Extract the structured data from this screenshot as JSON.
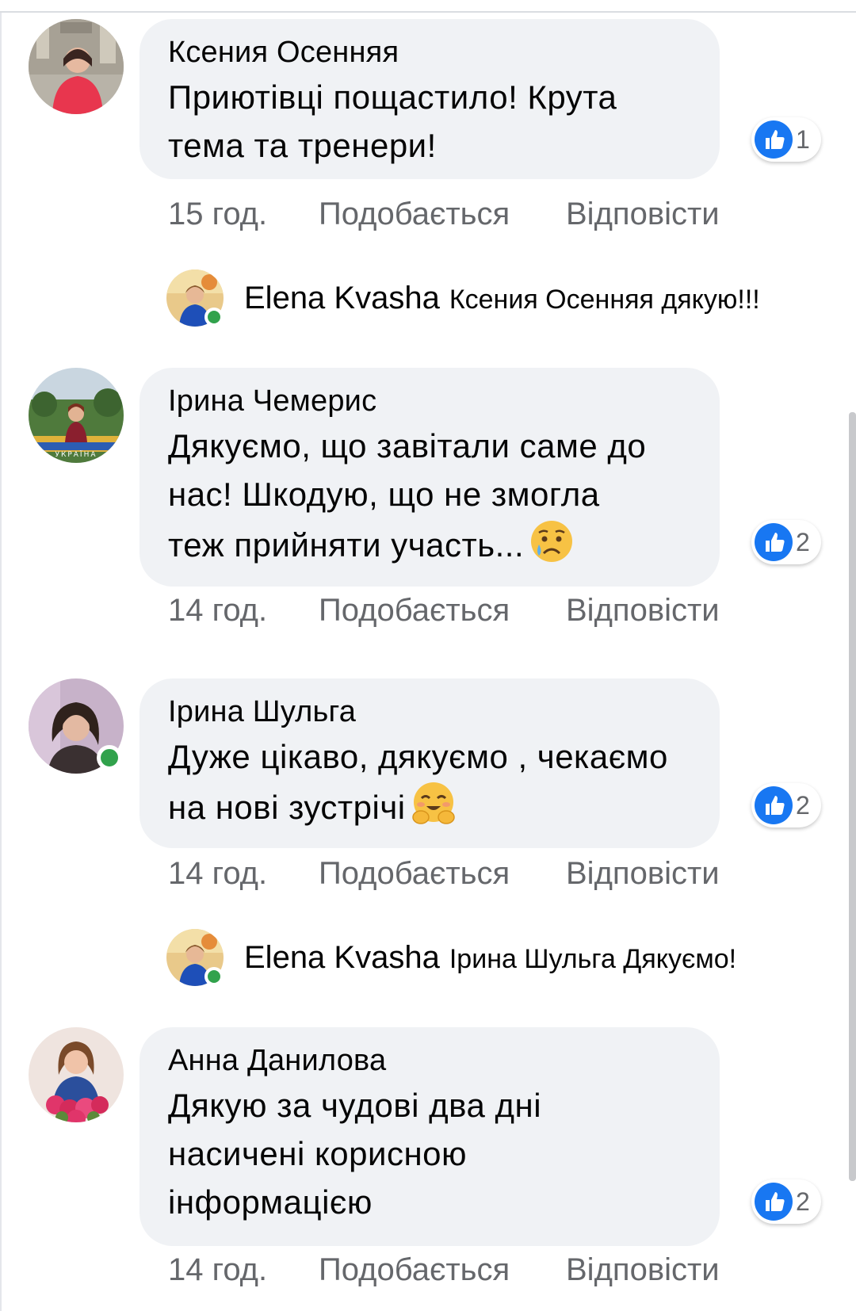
{
  "comments": [
    {
      "author": "Ксения Осенняя",
      "text_lines": [
        "Приютівці пощастило! Крута",
        "тема та тренери!"
      ],
      "reaction_count": "1",
      "time": "15 год.",
      "like_label": "Подобається",
      "reply_label": "Відповісти",
      "online": false,
      "reply": {
        "author": "Elena Kvasha",
        "text": "Ксения Осенняя дякую!!!",
        "online": true
      }
    },
    {
      "author": "Ірина Чемерис",
      "text_lines": [
        "Дякуємо, що завітали саме до",
        "нас! Шкодую, що не змогла",
        "теж прийняти участь..."
      ],
      "emoji": "sad-tear-emoji",
      "reaction_count": "2",
      "time": "14 год.",
      "like_label": "Подобається",
      "reply_label": "Відповісти",
      "online": false
    },
    {
      "author": "Ірина Шульга",
      "text_lines": [
        "Дуже цікаво, дякуємо , чекаємо",
        "на нові зустрічі"
      ],
      "emoji": "hugging-emoji",
      "reaction_count": "2",
      "time": "14 год.",
      "like_label": "Подобається",
      "reply_label": "Відповісти",
      "online": true,
      "reply": {
        "author": "Elena Kvasha",
        "text": "Ірина Шульга Дякуємо!",
        "online": true
      }
    },
    {
      "author": "Анна Данилова",
      "text_lines": [
        "Дякую за чудові два дні",
        "насичені корисною",
        "інформацією"
      ],
      "reaction_count": "2",
      "time": "14 год.",
      "like_label": "Подобається",
      "reply_label": "Відповісти",
      "online": false
    }
  ],
  "colors": {
    "bubble": "#f0f2f5",
    "meta_text": "#65676b",
    "like_blue": "#1877f2",
    "online_green": "#31a24c"
  }
}
